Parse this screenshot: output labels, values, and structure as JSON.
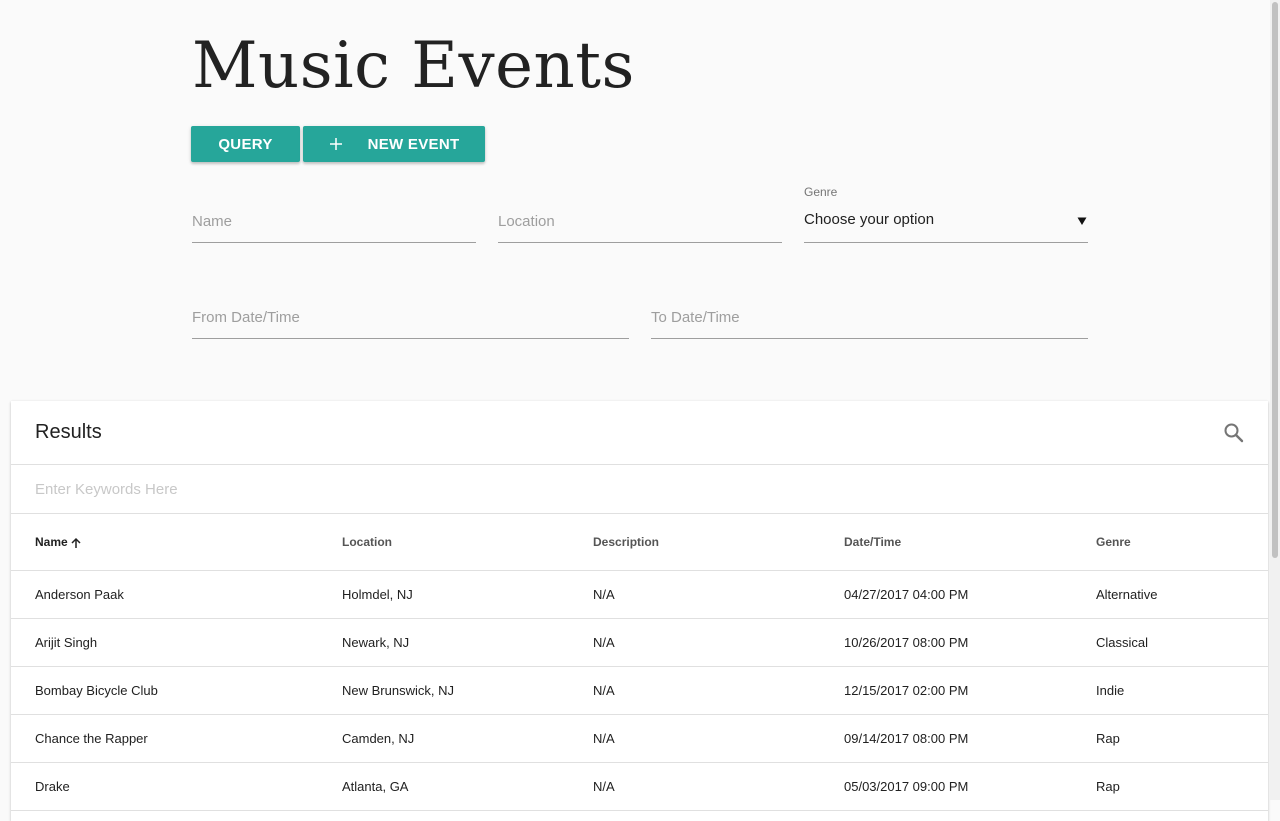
{
  "page": {
    "title": "Music Events"
  },
  "toolbar": {
    "query_label": "Query",
    "new_event_label": "New Event",
    "accent_color": "#26a69a"
  },
  "filters": {
    "name_placeholder": "Name",
    "location_placeholder": "Location",
    "genre_label": "Genre",
    "genre_selected": "Choose your option",
    "from_placeholder": "From Date/Time",
    "to_placeholder": "To Date/Time"
  },
  "results": {
    "title": "Results",
    "search_placeholder": "Enter Keywords Here",
    "columns": [
      "Name",
      "Location",
      "Description",
      "Date/Time",
      "Genre"
    ],
    "sort_column": "Name",
    "sort_direction": "ascending",
    "rows": [
      [
        "Anderson Paak",
        "Holmdel, NJ",
        "N/A",
        "04/27/2017 04:00 PM",
        "Alternative"
      ],
      [
        "Arijit Singh",
        "Newark, NJ",
        "N/A",
        "10/26/2017 08:00 PM",
        "Classical"
      ],
      [
        "Bombay Bicycle Club",
        "New Brunswick, NJ",
        "N/A",
        "12/15/2017 02:00 PM",
        "Indie"
      ],
      [
        "Chance the Rapper",
        "Camden, NJ",
        "N/A",
        "09/14/2017 08:00 PM",
        "Rap"
      ],
      [
        "Drake",
        "Atlanta, GA",
        "N/A",
        "05/03/2017 09:00 PM",
        "Rap"
      ]
    ]
  },
  "icons": {
    "plus": "plus-icon",
    "search": "search-icon",
    "caret": "caret-down-icon",
    "sort": "arrow-up-icon"
  }
}
